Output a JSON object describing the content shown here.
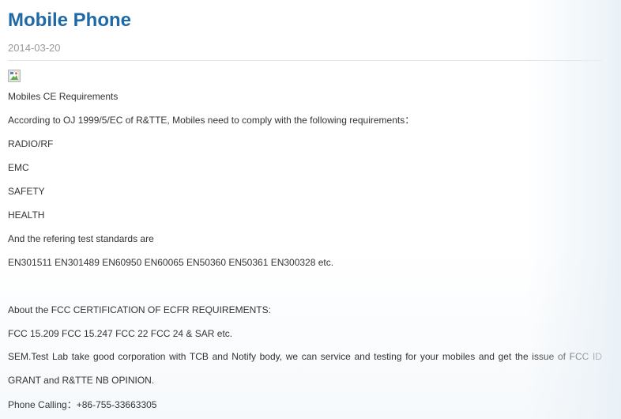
{
  "article": {
    "title": "Mobile Phone",
    "date": "2014-03-20",
    "image_icon": "broken-image-icon",
    "lines": [
      "Mobiles CE Requirements",
      "According to OJ 1999/5/EC of R&TTE, Mobiles need to comply with the following requirements：",
      "RADIO/RF",
      "EMC",
      "SAFETY",
      "HEALTH",
      "And the refering test standards are",
      "EN301511 EN301489 EN60950 EN60065 EN50360 EN50361 EN300328 etc.",
      "About the FCC CERTIFICATION OF ECFR REQUIREMENTS:",
      "FCC 15.209 FCC 15.247 FCC 22 FCC 24 & SAR etc."
    ],
    "service_paragraph": "SEM.Test Lab take good corporation with TCB and Notify body, we can service and testing for your mobiles and get the issue of FCC ID GRANT and R&TTE NB OPINION.",
    "phone_line": "Phone Calling：+86-755-33663305"
  }
}
